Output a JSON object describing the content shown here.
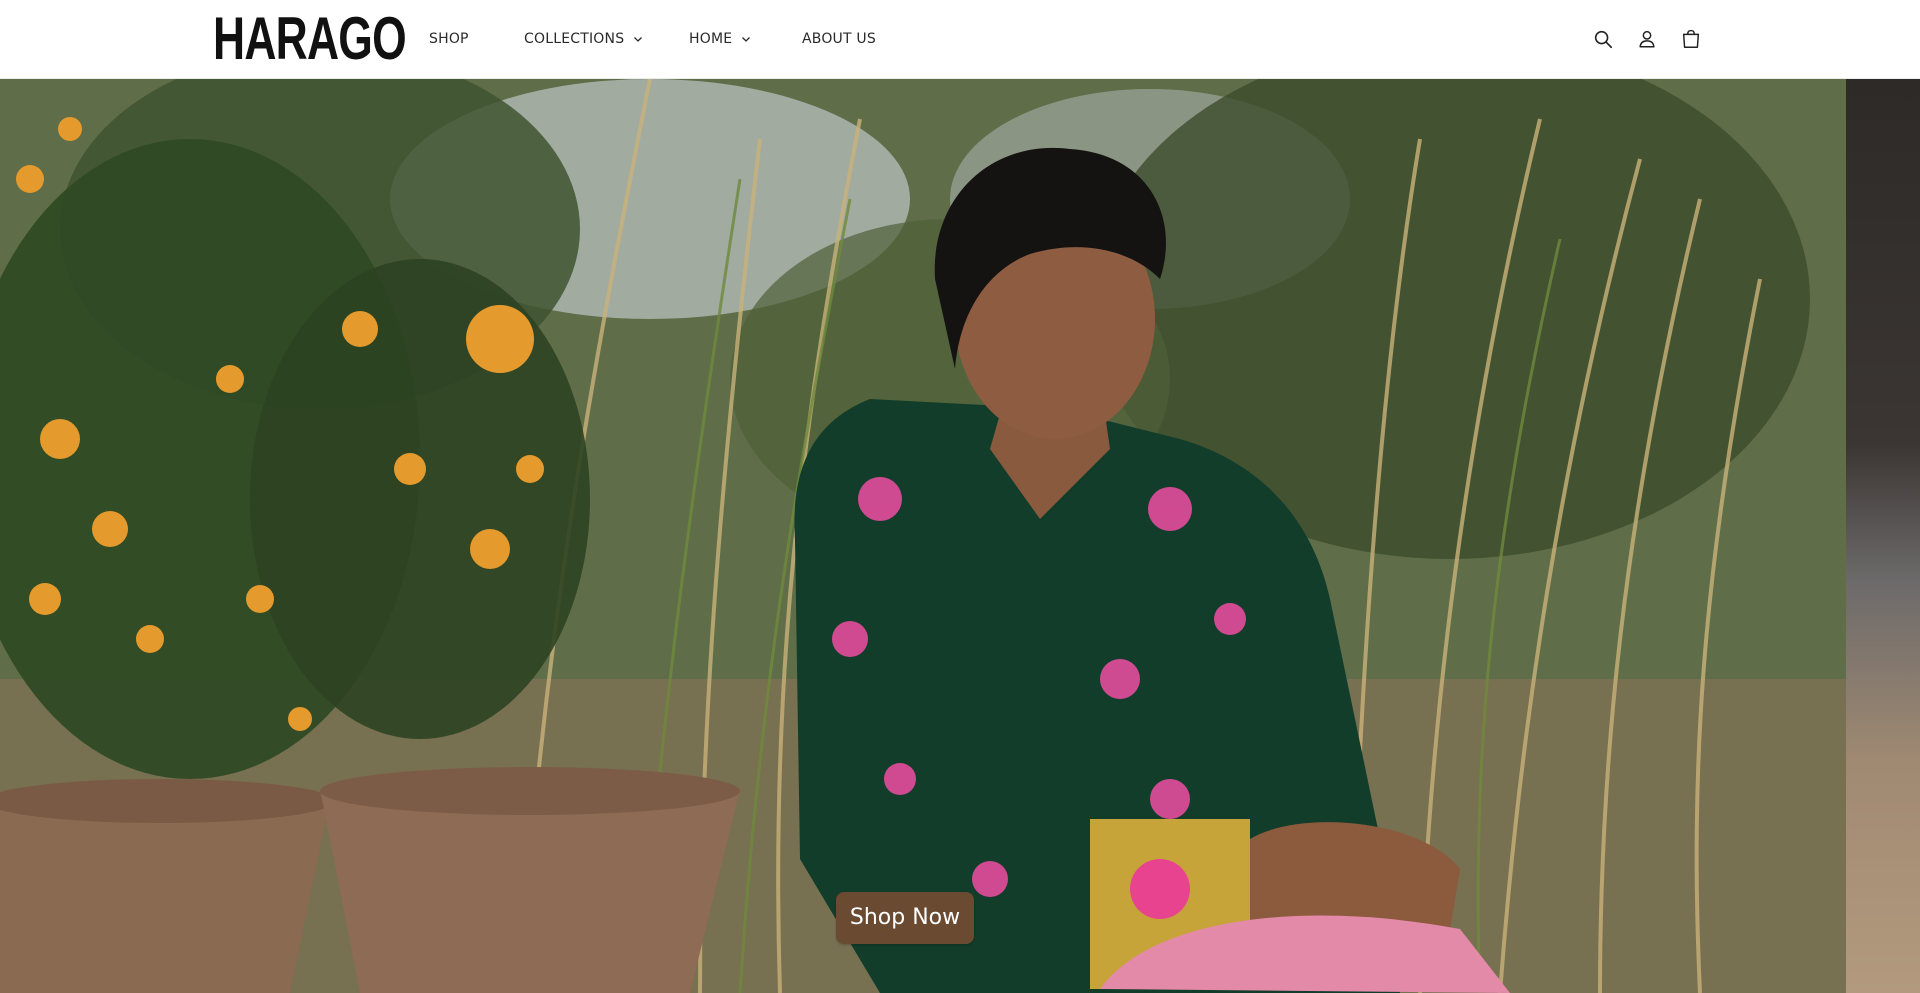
{
  "brand": {
    "logo_text": "HARAGO"
  },
  "nav": {
    "items": [
      {
        "label": "SHOP",
        "has_dropdown": false
      },
      {
        "label": "COLLECTIONS",
        "has_dropdown": true
      },
      {
        "label": "HOME",
        "has_dropdown": true
      },
      {
        "label": "ABOUT US",
        "has_dropdown": false
      }
    ]
  },
  "header_icons": [
    "search-icon",
    "account-icon",
    "cart-icon"
  ],
  "hero": {
    "cta_label": "Shop Now",
    "image_subject": "",
    "colors": {
      "cta_bg": "#6b4a32",
      "cta_text": "#ffffff",
      "shirt": "#123d2a",
      "flowers": "#e8a030"
    }
  }
}
